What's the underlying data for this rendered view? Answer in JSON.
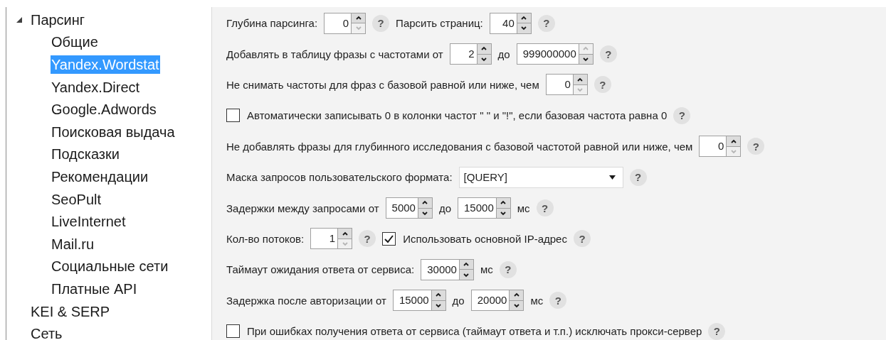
{
  "sidebar": {
    "items": [
      {
        "label": "Парсинг",
        "expanded": true,
        "selected": false,
        "children": [
          {
            "label": "Общие",
            "selected": false
          },
          {
            "label": "Yandex.Wordstat",
            "selected": true
          },
          {
            "label": "Yandex.Direct",
            "selected": false
          },
          {
            "label": "Google.Adwords",
            "selected": false
          },
          {
            "label": "Поисковая выдача",
            "selected": false
          },
          {
            "label": "Подсказки",
            "selected": false
          },
          {
            "label": "Рекомендации",
            "selected": false
          },
          {
            "label": "SeoPult",
            "selected": false
          },
          {
            "label": "LiveInternet",
            "selected": false
          },
          {
            "label": "Mail.ru",
            "selected": false
          },
          {
            "label": "Социальные сети",
            "selected": false
          },
          {
            "label": "Платные API",
            "selected": false
          }
        ]
      },
      {
        "label": "KEI & SERP",
        "selected": false
      },
      {
        "label": "Сеть",
        "selected": false
      }
    ]
  },
  "form": {
    "rows": [
      {
        "items": [
          {
            "kind": "label",
            "text": "Глубина парсинга:"
          },
          {
            "kind": "spinner",
            "value": "0",
            "up_disabled": false,
            "down_disabled": true
          },
          {
            "kind": "help",
            "text": "?"
          },
          {
            "kind": "label",
            "text": "Парсить страниц:"
          },
          {
            "kind": "spinner",
            "value": "40",
            "up_disabled": false,
            "down_disabled": false
          },
          {
            "kind": "help",
            "text": "?"
          }
        ]
      },
      {
        "items": [
          {
            "kind": "label",
            "text": "Добавлять в таблицу фразы с частотами от"
          },
          {
            "kind": "spinner",
            "value": "2",
            "up_disabled": false,
            "down_disabled": false
          },
          {
            "kind": "label",
            "text": "до"
          },
          {
            "kind": "spinner",
            "value": "999000000",
            "up_disabled": true,
            "down_disabled": false
          },
          {
            "kind": "help",
            "text": "?"
          }
        ]
      },
      {
        "items": [
          {
            "kind": "label",
            "text": "Не снимать частоты для фраз с базовой равной или ниже, чем"
          },
          {
            "kind": "spinner",
            "value": "0",
            "up_disabled": false,
            "down_disabled": true
          },
          {
            "kind": "help",
            "text": "?"
          }
        ]
      },
      {
        "items": [
          {
            "kind": "checkbox",
            "checked": false,
            "text": "Автоматически записывать 0 в колонки частот \" \" и \"!\", если базовая частота равна 0"
          },
          {
            "kind": "help",
            "text": "?"
          }
        ]
      },
      {
        "items": [
          {
            "kind": "label",
            "text": "Не добавлять фразы для глубинного исследования с базовой частотой равной или ниже, чем"
          },
          {
            "kind": "spinner",
            "value": "0",
            "up_disabled": false,
            "down_disabled": true
          },
          {
            "kind": "help",
            "text": "?"
          }
        ]
      },
      {
        "items": [
          {
            "kind": "label",
            "text": "Маска запросов пользовательского формата:"
          },
          {
            "kind": "combo",
            "value": "[QUERY]"
          },
          {
            "kind": "help",
            "text": "?"
          }
        ]
      },
      {
        "items": [
          {
            "kind": "label",
            "text": "Задержки между запросами от"
          },
          {
            "kind": "spinner",
            "value": "5000",
            "up_disabled": false,
            "down_disabled": false
          },
          {
            "kind": "label",
            "text": "до"
          },
          {
            "kind": "spinner",
            "value": "15000",
            "up_disabled": false,
            "down_disabled": false
          },
          {
            "kind": "label",
            "text": "мс"
          },
          {
            "kind": "help",
            "text": "?"
          }
        ]
      },
      {
        "items": [
          {
            "kind": "label",
            "text": "Кол-во потоков:"
          },
          {
            "kind": "spinner",
            "value": "1",
            "up_disabled": false,
            "down_disabled": true
          },
          {
            "kind": "help",
            "text": "?"
          },
          {
            "kind": "checkbox",
            "checked": true,
            "text": "Использовать основной IP-адрес"
          },
          {
            "kind": "help",
            "text": "?"
          }
        ]
      },
      {
        "items": [
          {
            "kind": "label",
            "text": "Таймаут ожидания ответа от сервиса:"
          },
          {
            "kind": "spinner",
            "value": "30000",
            "up_disabled": false,
            "down_disabled": false
          },
          {
            "kind": "label",
            "text": "мс"
          },
          {
            "kind": "help",
            "text": "?"
          }
        ]
      },
      {
        "items": [
          {
            "kind": "label",
            "text": "Задержка после авторизации от"
          },
          {
            "kind": "spinner",
            "value": "15000",
            "up_disabled": false,
            "down_disabled": false
          },
          {
            "kind": "label",
            "text": "до"
          },
          {
            "kind": "spinner",
            "value": "20000",
            "up_disabled": false,
            "down_disabled": false
          },
          {
            "kind": "label",
            "text": "мс"
          },
          {
            "kind": "help",
            "text": "?"
          }
        ]
      },
      {
        "items": [
          {
            "kind": "checkbox",
            "checked": false,
            "text": "При ошибках получения ответа от сервиса (таймаут ответа и т.п.) исключать прокси-сервер"
          },
          {
            "kind": "help",
            "text": "?"
          }
        ]
      }
    ]
  }
}
